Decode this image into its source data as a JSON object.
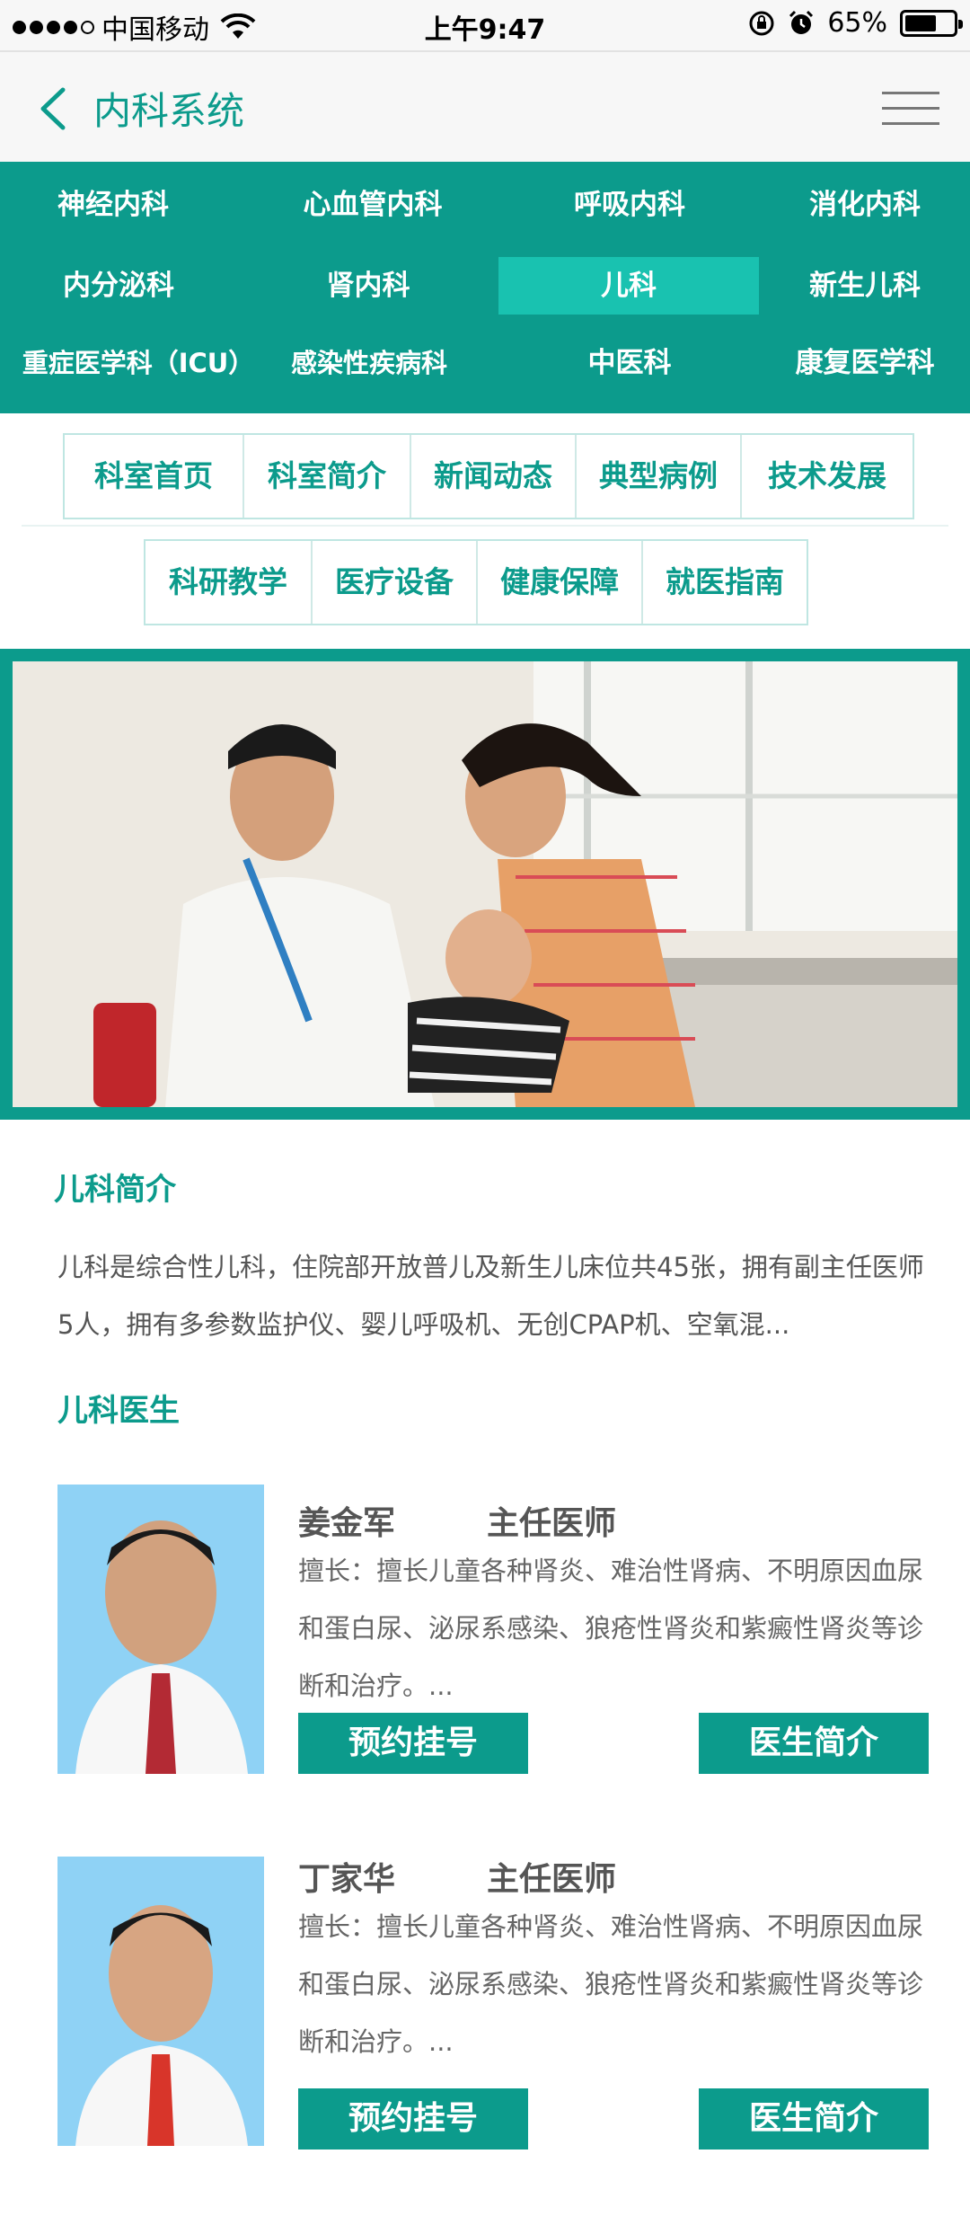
{
  "status_bar": {
    "carrier": "中国移动",
    "time": "上午9:47",
    "battery_percent": "65%",
    "battery_level": 0.65,
    "icons": [
      "signal-dots-icon",
      "wifi-icon",
      "rotation-lock-icon",
      "alarm-icon",
      "battery-icon"
    ]
  },
  "header": {
    "title": "内科系统",
    "back_icon": "chevron-left-icon",
    "menu_icon": "hamburger-menu-icon"
  },
  "departments": [
    {
      "label": "神经内科",
      "active": false
    },
    {
      "label": "心血管内科",
      "active": false
    },
    {
      "label": "呼吸内科",
      "active": false
    },
    {
      "label": "消化内科",
      "active": false
    },
    {
      "label": "内分泌科",
      "active": false
    },
    {
      "label": "肾内科",
      "active": false
    },
    {
      "label": "儿科",
      "active": true
    },
    {
      "label": "新生儿科",
      "active": false
    },
    {
      "label": "重症医学科（ICU）",
      "active": false
    },
    {
      "label": "感染性疾病科",
      "active": false
    },
    {
      "label": "中医科",
      "active": false
    },
    {
      "label": "康复医学科",
      "active": false
    }
  ],
  "subnav_row1": [
    "科室首页",
    "科室简介",
    "新闻动态",
    "典型病例",
    "技术发展"
  ],
  "subnav_row2": [
    "科研教学",
    "医疗设备",
    "健康保障",
    "就医指南"
  ],
  "intro": {
    "title": "儿科简介",
    "text": "儿科是综合性儿科，住院部开放普儿及新生儿床位共45张，拥有副主任医师5人，拥有多参数监护仪、婴儿呼吸机、无创CPAP机、空氧混..."
  },
  "doctors_section": {
    "title": "儿科医生",
    "doctors": [
      {
        "name": "姜金军",
        "title": "主任医师",
        "desc": "擅长：擅长儿童各种肾炎、难治性肾病、不明原因血尿和蛋白尿、泌尿系感染、狼疮性肾炎和紫癜性肾炎等诊断和治疗。...",
        "book_label": "预约挂号",
        "profile_label": "医生简介"
      },
      {
        "name": "丁家华",
        "title": "主任医师",
        "desc": "擅长：擅长儿童各种肾炎、难治性肾病、不明原因血尿和蛋白尿、泌尿系感染、狼疮性肾炎和紫癜性肾炎等诊断和治疗。...",
        "book_label": "预约挂号",
        "profile_label": "医生简介"
      }
    ]
  },
  "colors": {
    "brand": "#0c9b8c",
    "active_tab": "#19c2b0",
    "photo_bg": "#8fd2f5"
  }
}
